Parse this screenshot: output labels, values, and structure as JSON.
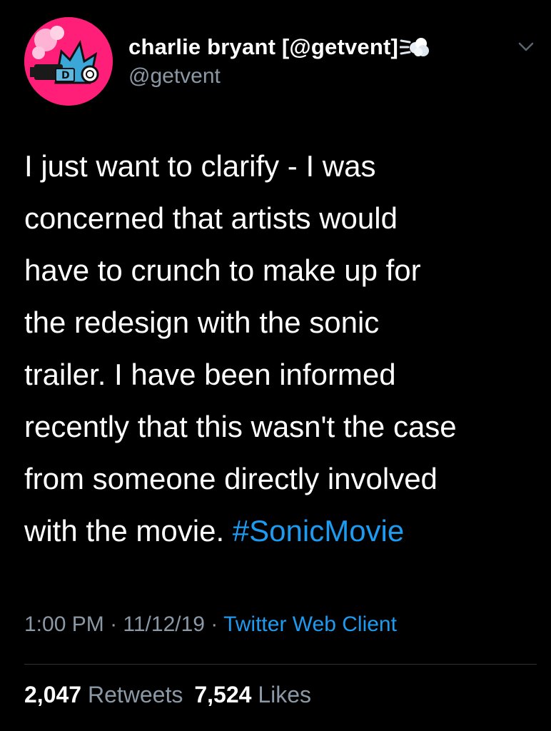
{
  "author": {
    "display_name": "charlie bryant [@getvent]",
    "handle": "@getvent",
    "avatar_icon": "pink-cartoon-character-avatar",
    "name_emoji": "dash-cloud-emoji"
  },
  "tweet": {
    "lines": [
      "I just want to clarify - I was",
      "concerned that artists would",
      "have to crunch to make up for",
      "the redesign with the sonic",
      "trailer.  I have been informed",
      "recently that this wasn't the case",
      "from someone directly involved",
      "with the movie. "
    ],
    "hashtag": "#SonicMovie"
  },
  "meta": {
    "time": "1:00 PM",
    "separator1": " · ",
    "date": "11/12/19",
    "separator2": " · ",
    "client": "Twitter Web Client"
  },
  "stats": {
    "retweets_count": "2,047",
    "retweets_label": "Retweets",
    "likes_count": "7,524",
    "likes_label": "Likes"
  },
  "colors": {
    "background": "#000000",
    "text": "#ffffff",
    "secondary": "#8b98a5",
    "link": "#1d9bf0",
    "avatar_bg": "#ff1f78"
  }
}
